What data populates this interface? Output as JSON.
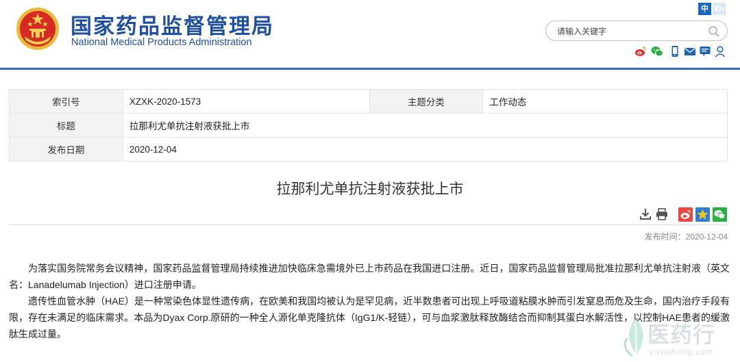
{
  "header": {
    "org_name_cn": "国家药品监督管理局",
    "org_name_en": "National Medical Products Administration",
    "lang_zh": "中",
    "lang_en": "En",
    "search_placeholder": "请输入关键字",
    "tools": [
      "weibo-icon",
      "wechat-icon",
      "mobile-icon",
      "mail-icon",
      "message-icon",
      "user-icon"
    ],
    "accent_color": "#1f4fa1"
  },
  "info_table": {
    "index_label": "索引号",
    "index_value": "XZXK-2020-1573",
    "category_label": "主题分类",
    "category_value": "工作动态",
    "title_label": "标题",
    "title_value": "拉那利尤单抗注射液获批上市",
    "date_label": "发布日期",
    "date_value": "2020-12-04"
  },
  "article": {
    "title": "拉那利尤单抗注射液获批上市",
    "publish_time": "发布时间：2020-12-04",
    "paragraphs": [
      "为落实国务院常务会议精神，国家药品监督管理局持续推进加快临床急需境外已上市药品在我国进口注册。近日，国家药品监督管理局批准拉那利尤单抗注射液（英文名：Lanadelumab Injection）进口注册申请。",
      "遗传性血管水肿（HAE）是一种常染色体显性遗传病，在欧美和我国均被认为是罕见病，近半数患者可出现上呼吸道粘膜水肿而引发窒息而危及生命，国内治疗手段有限，存在未满足的临床需求。本品为Dyax Corp.原研的一种全人源化单克隆抗体（IgG1/K-轻链），可与血浆激肽释放酶结合而抑制其蛋白水解活性，以控制HAE患者的缓激肽生成过量。"
    ]
  },
  "watermark": {
    "text_cn": "医药行",
    "url": "yiyaohang.com"
  }
}
